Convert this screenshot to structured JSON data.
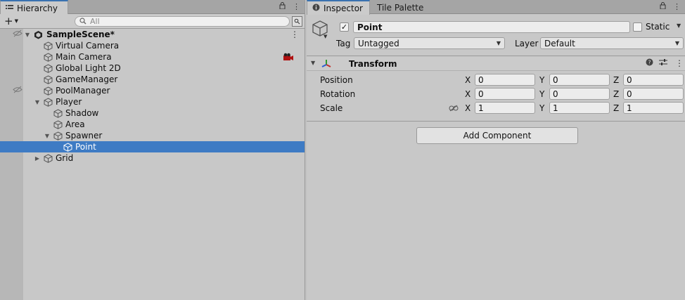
{
  "hierarchy": {
    "tab_label": "Hierarchy",
    "search_placeholder": "All",
    "scene": {
      "name": "SampleScene*"
    },
    "items": [
      {
        "label": "Virtual Camera",
        "depth": 1
      },
      {
        "label": "Main Camera",
        "depth": 1
      },
      {
        "label": "Global Light 2D",
        "depth": 1
      },
      {
        "label": "GameManager",
        "depth": 1
      },
      {
        "label": "PoolManager",
        "depth": 1
      },
      {
        "label": "Player",
        "depth": 1,
        "expanded": true
      },
      {
        "label": "Shadow",
        "depth": 2
      },
      {
        "label": "Area",
        "depth": 2
      },
      {
        "label": "Spawner",
        "depth": 2,
        "expanded": true
      },
      {
        "label": "Point",
        "depth": 3,
        "selected": true
      },
      {
        "label": "Grid",
        "depth": 1,
        "collapsed": true
      }
    ]
  },
  "inspector": {
    "tab_label": "Inspector",
    "second_tab_label": "Tile Palette",
    "object_name": "Point",
    "active": true,
    "static_label": "Static",
    "static_checked": false,
    "tag_label": "Tag",
    "tag_value": "Untagged",
    "layer_label": "Layer",
    "layer_value": "Default",
    "transform": {
      "title": "Transform",
      "position_label": "Position",
      "rotation_label": "Rotation",
      "scale_label": "Scale",
      "axis_x": "X",
      "axis_y": "Y",
      "axis_z": "Z",
      "position": {
        "x": "0",
        "y": "0",
        "z": "0"
      },
      "rotation": {
        "x": "0",
        "y": "0",
        "z": "0"
      },
      "scale": {
        "x": "1",
        "y": "1",
        "z": "1"
      }
    },
    "add_component_label": "Add Component"
  },
  "colors": {
    "selection": "#3e7bc4",
    "active_tab_accent": "#3a72b0",
    "panel_bg": "#c8c8c8"
  },
  "icons": {
    "hierarchy_tab": "list-icon",
    "inspector_tab": "info-icon",
    "scene": "unity-logo-icon",
    "game_object": "cube-icon",
    "transform": "transform-axes-icon",
    "camera_gizmo": "camera-gizmo-icon",
    "hidden": "eye-hidden-icon",
    "lock": "lock-icon",
    "menu": "kebab-menu-icon",
    "help": "help-icon",
    "preset": "sliders-icon",
    "constrain_proportions": "link-icon"
  }
}
